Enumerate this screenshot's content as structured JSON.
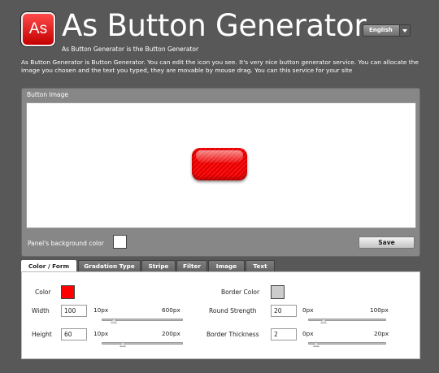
{
  "header": {
    "logo_text": "As",
    "title": "As Button Generator",
    "subtitle": "As Button Generator is the Button Generator",
    "language": "English"
  },
  "description": "As Button Generator is Button Generator. You can edit the icon you see. It's very nice button generator service. You can allocate the image you chosen and the text you typed, they are movable by mouse drag. You can this service for your site",
  "button_panel": {
    "label": "Button Image",
    "bg_color_label": "Panel's background color",
    "bg_color": "#ffffff",
    "save_label": "Save",
    "preview_color": "#ff0000"
  },
  "tabs": [
    "Color / Form",
    "Gradation Type",
    "Stripe",
    "Filter",
    "Image",
    "Text"
  ],
  "active_tab": 0,
  "form": {
    "color_label": "Color",
    "color_value": "#ff0000",
    "border_color_label": "Border Color",
    "border_color_value": "#cccccc",
    "width": {
      "label": "Width",
      "value": "100",
      "min": "10px",
      "max": "600px",
      "fraction": 0.15
    },
    "height": {
      "label": "Height",
      "value": "60",
      "min": "10px",
      "max": "200px",
      "fraction": 0.26
    },
    "round_strength": {
      "label": "Round Strength",
      "value": "20",
      "min": "0px",
      "max": "100px",
      "fraction": 0.2
    },
    "border_thickness": {
      "label": "Border Thickness",
      "value": "2",
      "min": "0px",
      "max": "20px",
      "fraction": 0.1
    }
  }
}
